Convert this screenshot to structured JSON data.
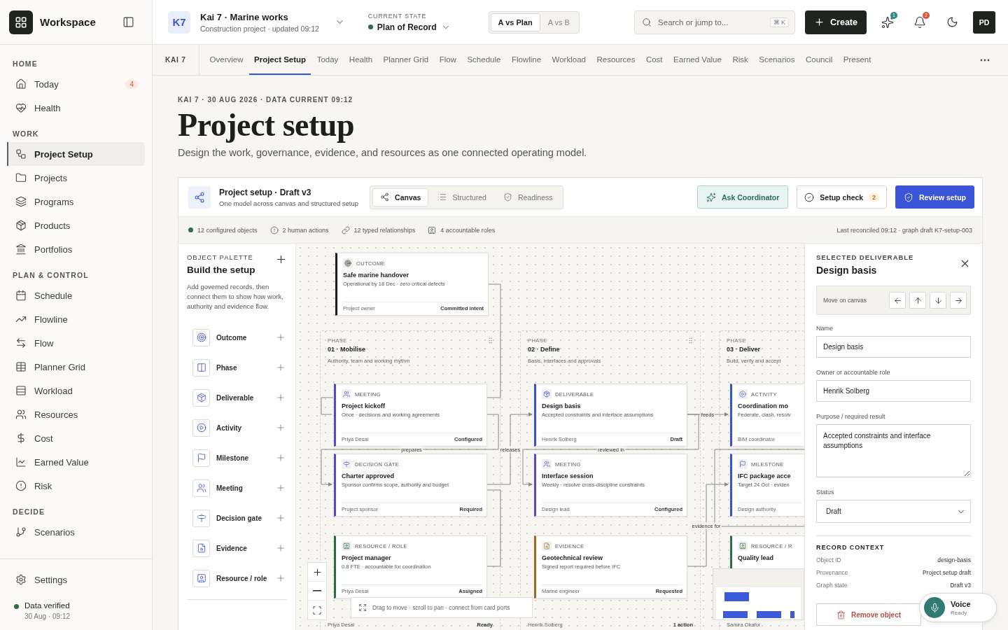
{
  "sidebar": {
    "brand": "Workspace",
    "sections": [
      {
        "heading": "HOME",
        "items": [
          {
            "label": "Today",
            "badge": "4",
            "selected": false
          },
          {
            "label": "Health",
            "selected": false
          }
        ]
      },
      {
        "heading": "WORK",
        "items": [
          {
            "label": "Project Setup",
            "selected": true
          },
          {
            "label": "Projects",
            "selected": false
          },
          {
            "label": "Programs",
            "selected": false
          },
          {
            "label": "Products",
            "selected": false
          },
          {
            "label": "Portfolios",
            "selected": false
          }
        ]
      },
      {
        "heading": "PLAN & CONTROL",
        "items": [
          {
            "label": "Schedule",
            "selected": false
          },
          {
            "label": "Flowline",
            "selected": false
          },
          {
            "label": "Flow",
            "selected": false
          },
          {
            "label": "Planner Grid",
            "selected": false
          },
          {
            "label": "Workload",
            "selected": false
          },
          {
            "label": "Resources",
            "selected": false
          },
          {
            "label": "Cost",
            "selected": false
          },
          {
            "label": "Earned Value",
            "selected": false
          },
          {
            "label": "Risk",
            "selected": false
          }
        ]
      },
      {
        "heading": "DECIDE",
        "items": [
          {
            "label": "Scenarios",
            "selected": false
          }
        ]
      }
    ],
    "settings": "Settings",
    "status": "Data verified",
    "status_time": "30 Aug · 09:12"
  },
  "header": {
    "code": "K7",
    "project": "Kai 7 · Marine works",
    "meta": "Construction project · updated 09:12",
    "state_label": "CURRENT STATE",
    "state_value": "Plan of Record",
    "compare": [
      {
        "label": "A vs Plan",
        "selected": true
      },
      {
        "label": "A vs B",
        "selected": false
      }
    ],
    "search": {
      "placeholder": "Search or jump to...",
      "shortcut": "⌘ K"
    },
    "create": "Create",
    "assistant_badge": "1",
    "alerts_badge": "2",
    "avatar": "PD"
  },
  "tabs": {
    "context": "KAI 7",
    "items": [
      {
        "label": "Overview",
        "selected": false
      },
      {
        "label": "Project Setup",
        "selected": true
      },
      {
        "label": "Today",
        "selected": false
      },
      {
        "label": "Health",
        "selected": false
      },
      {
        "label": "Planner Grid",
        "selected": false
      },
      {
        "label": "Flow",
        "selected": false
      },
      {
        "label": "Schedule",
        "selected": false
      },
      {
        "label": "Flowline",
        "selected": false
      },
      {
        "label": "Workload",
        "selected": false
      },
      {
        "label": "Resources",
        "selected": false
      },
      {
        "label": "Cost",
        "selected": false
      },
      {
        "label": "Earned Value",
        "selected": false
      },
      {
        "label": "Risk",
        "selected": false
      },
      {
        "label": "Scenarios",
        "selected": false
      },
      {
        "label": "Council",
        "selected": false
      },
      {
        "label": "Present",
        "selected": false
      }
    ]
  },
  "page": {
    "eyebrow": "KAI 7 · 30 AUG 2026 · DATA CURRENT 09:12",
    "title": "Project setup",
    "subtitle": "Design the work, governance, evidence, and resources as one connected operating model."
  },
  "setup": {
    "title": "Project setup · Draft v3",
    "subtitle": "One model across canvas and structured setup",
    "views": [
      {
        "kind": "canvas",
        "label": "Canvas",
        "selected": true
      },
      {
        "kind": "structured",
        "label": "Structured",
        "selected": false
      },
      {
        "kind": "readiness",
        "label": "Readiness",
        "selected": false
      }
    ],
    "ask": "Ask Coordinator",
    "check": "Setup check",
    "check_count": "2",
    "review": "Review setup",
    "stats": [
      {
        "kind": "dot",
        "text": "12 configured objects"
      },
      {
        "kind": "alert",
        "text": "2 human actions"
      },
      {
        "kind": "link",
        "text": "12 typed relationships"
      },
      {
        "kind": "role",
        "text": "4 accountable roles"
      }
    ],
    "reconciled": "Last reconciled 09:12 · graph draft K7-setup-003"
  },
  "palette": {
    "eyebrow": "OBJECT PALETTE",
    "title": "Build the setup",
    "description": "Add governed records, then connect them to show how work, authority and evidence flow.",
    "items": [
      {
        "kind": "outcome",
        "label": "Outcome"
      },
      {
        "kind": "phase",
        "label": "Phase"
      },
      {
        "kind": "deliverable",
        "label": "Deliverable"
      },
      {
        "kind": "activity",
        "label": "Activity"
      },
      {
        "kind": "milestone",
        "label": "Milestone"
      },
      {
        "kind": "meeting",
        "label": "Meeting"
      },
      {
        "kind": "decision_gate",
        "label": "Decision gate"
      },
      {
        "kind": "evidence",
        "label": "Evidence"
      },
      {
        "kind": "resource",
        "label": "Resource / role"
      }
    ]
  },
  "canvas": {
    "outcome": {
      "kind": "outcome",
      "label": "OUTCOME",
      "title": "Safe marine handover",
      "subtitle": "Operational by 18 Dec · zero critical defects",
      "owner": "Project owner",
      "status": "Committed intent"
    },
    "phases": [
      {
        "eyebrow": "PHASE",
        "title": "01 · Mobilise",
        "description": "Authority, team and working rhythm",
        "owner": "Priya Desai",
        "status": "Ready",
        "cards": [
          {
            "kind": "meeting",
            "label": "MEETING",
            "title": "Project kickoff",
            "subtitle": "Once · decisions and working agreements",
            "owner": "Priya Desai",
            "status": "Configured"
          },
          {
            "kind": "decision_gate",
            "label": "DECISION GATE",
            "title": "Charter approved",
            "subtitle": "Sponsor confirms scope, authority and budget",
            "owner": "Project sponsor",
            "status": "Required"
          },
          {
            "kind": "resource",
            "label": "RESOURCE / ROLE",
            "title": "Project manager",
            "subtitle": "0.8 FTE · accountable for coordination",
            "owner": "Priya Desai",
            "status": "Assigned"
          }
        ]
      },
      {
        "eyebrow": "PHASE",
        "title": "02 · Define",
        "description": "Basis, interfaces and approvals",
        "owner": "Henrik Solberg",
        "status": "1 action",
        "cards": [
          {
            "kind": "deliverable",
            "label": "DELIVERABLE",
            "title": "Design basis",
            "subtitle": "Accepted constraints and interface assumptions",
            "owner": "Henrik Solberg",
            "status": "Draft"
          },
          {
            "kind": "meeting",
            "label": "MEETING",
            "title": "Interface session",
            "subtitle": "Weekly · resolve cross-discipline constraints",
            "owner": "Design lead",
            "status": "Configured"
          },
          {
            "kind": "evidence",
            "label": "EVIDENCE",
            "title": "Geotechnical review",
            "subtitle": "Signed report required before IFC",
            "owner": "Marine engineer",
            "status": "Requested"
          }
        ]
      },
      {
        "eyebrow": "PHASE",
        "title": "03 · Deliver",
        "description": "Build, verify and accept",
        "owner": "Samira Okafor",
        "cards": [
          {
            "kind": "activity",
            "label": "ACTIVITY",
            "title": "Coordination mo",
            "subtitle": "Federate, clash, resolv",
            "owner": "BIM coordinator"
          },
          {
            "kind": "milestone",
            "label": "MILESTONE",
            "title": "IFC package acce",
            "subtitle": "Target 24 Oct · eviden",
            "owner": "Design authority"
          },
          {
            "kind": "resource",
            "label": "RESOURCE / R",
            "title": "Quality lead"
          }
        ]
      }
    ],
    "edges": [
      {
        "label": "prepares"
      },
      {
        "label": "releases"
      },
      {
        "label": "reviewed in"
      },
      {
        "label": "feeds"
      },
      {
        "label": "evidence for"
      }
    ],
    "hint": "Drag to move · scroll to pan · connect from card ports"
  },
  "inspector": {
    "eyebrow": "SELECTED DELIVERABLE",
    "title": "Design basis",
    "move_label": "Move on canvas",
    "fields": [
      {
        "kind": "input",
        "label": "Name",
        "value": "Design basis"
      },
      {
        "kind": "input",
        "label": "Owner or accountable role",
        "value": "Henrik Solberg"
      },
      {
        "kind": "textarea",
        "label": "Purpose / required result",
        "value": "Accepted constraints and interface assumptions"
      },
      {
        "kind": "select",
        "label": "Status",
        "value": "Draft"
      }
    ],
    "context_heading": "RECORD CONTEXT",
    "context": [
      {
        "label": "Object ID",
        "value": "design-basis"
      },
      {
        "label": "Provenance",
        "value": "Project setup draft"
      },
      {
        "label": "Graph state",
        "value": "Draft v3"
      }
    ],
    "remove": "Remove object"
  },
  "voice": {
    "title": "Voice",
    "status": "Ready"
  }
}
